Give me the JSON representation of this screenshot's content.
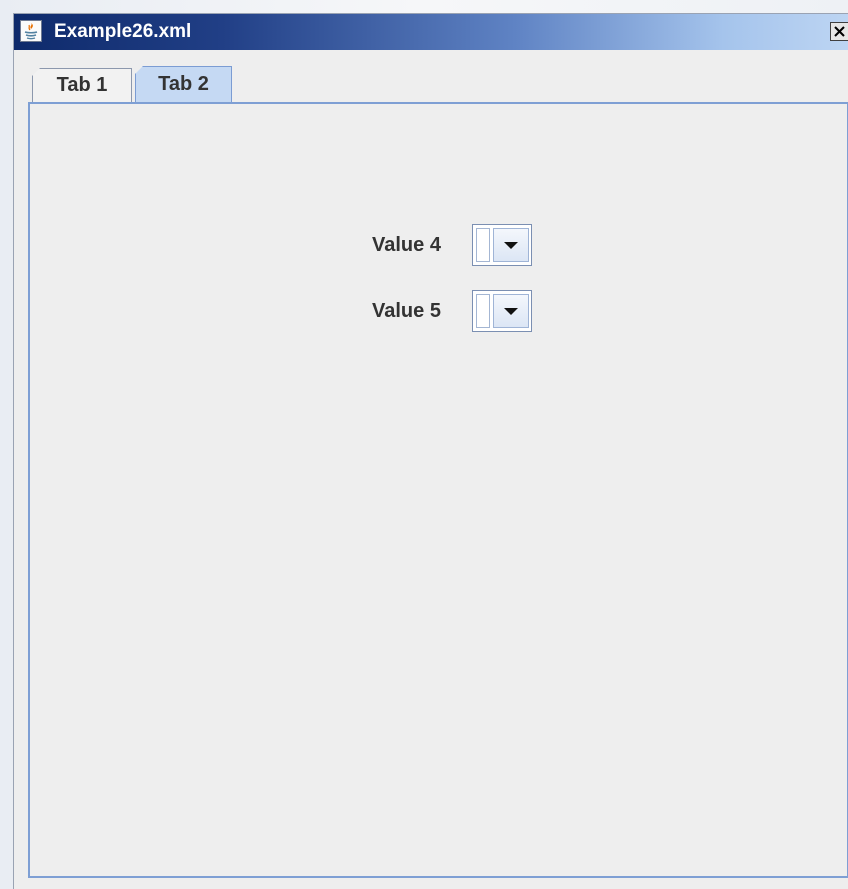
{
  "window": {
    "title": "Example26.xml",
    "app_icon": "java-icon",
    "close_icon": "close-icon",
    "title_bar_colors": [
      "#0e2a6b",
      "#5f83c4",
      "#bdd5f3"
    ]
  },
  "tabs": [
    {
      "label": "Tab 1",
      "selected": false
    },
    {
      "label": "Tab 2",
      "selected": true
    }
  ],
  "accent_color": "#7e9fd4",
  "fields": [
    {
      "label": "Value 4",
      "value": "",
      "control": "combo-box"
    },
    {
      "label": "Value 5",
      "value": "",
      "control": "combo-box"
    }
  ],
  "dropdown_icon": "chevron-down-icon"
}
